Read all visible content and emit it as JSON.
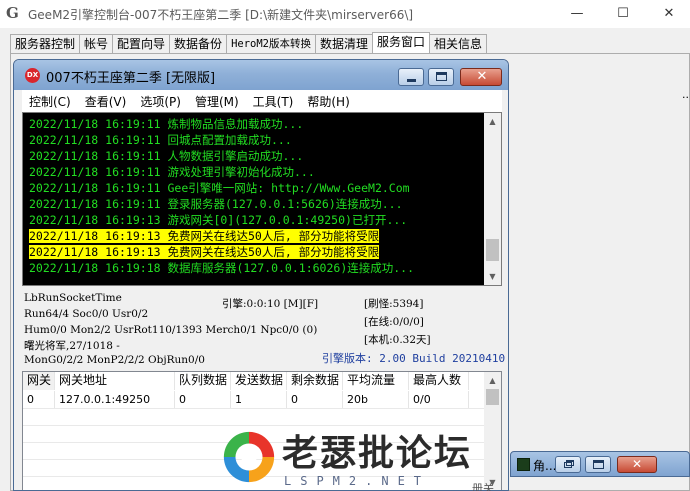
{
  "window": {
    "title": "GeeM2引擎控制台-007不朽王座第二季 [D:\\新建文件夹\\mirserver66\\]",
    "minimize": "—",
    "maximize": "☐",
    "close": "✕"
  },
  "main_tabs": [
    {
      "label": "服务器控制"
    },
    {
      "label": "帐号"
    },
    {
      "label": "配置向导"
    },
    {
      "label": "数据备份"
    },
    {
      "label": "HeroM2版本转换"
    },
    {
      "label": "数据清理"
    },
    {
      "label": "服务窗口"
    },
    {
      "label": "相关信息"
    }
  ],
  "inner_window": {
    "icon_text": "DX",
    "title": "007不朽王座第二季 [无限版]",
    "close": "✕",
    "menu": [
      {
        "label": "控制(C)"
      },
      {
        "label": "查看(V)"
      },
      {
        "label": "选项(P)"
      },
      {
        "label": "管理(M)"
      },
      {
        "label": "工具(T)"
      },
      {
        "label": "帮助(H)"
      }
    ]
  },
  "console": {
    "lines": [
      {
        "text": "2022/11/18 16:19:11 炼制物品信息加载成功..."
      },
      {
        "text": "2022/11/18 16:19:11 回城点配置加载成功..."
      },
      {
        "text": "2022/11/18 16:19:11 人物数据引擎启动成功..."
      },
      {
        "text": "2022/11/18 16:19:11 游戏处理引擎初始化成功..."
      },
      {
        "text": "2022/11/18 16:19:11 Gee引擎唯一网站: http://Www.GeeM2.Com"
      },
      {
        "text": "2022/11/18 16:19:11 登录服务器(127.0.0.1:5626)连接成功..."
      },
      {
        "text": "2022/11/18 16:19:13 游戏网关[0](127.0.0.1:49250)已打开..."
      },
      {
        "text": "2022/11/18 16:19:13 免费网关在线达50人后, 部分功能将受限"
      },
      {
        "text": "2022/11/18 16:19:13 免费网关在线达50人后, 部分功能将受限"
      },
      {
        "text": "2022/11/18 16:19:18 数据库服务器(127.0.0.1:6026)连接成功..."
      }
    ]
  },
  "status": {
    "socket": "LbRunSocketTime",
    "engine_time": "引擎:0:0:10 [M][F]",
    "refresh_monsters": "[刷怪:5394]",
    "run_stats": "Run64/4 Soc0/0 Usr0/2",
    "online": "[在线:0/0/0]",
    "hum_stats": "Hum0/0 Mon2/2 UsrRot110/1393 Merch0/1 Npc0/0 (0)",
    "local_time": "[本机:0.32天]",
    "map_info": "曙光将军,27/1018 -",
    "mon_stats": "MonG0/2/2 MonP2/2/2 ObjRun0/0",
    "engine_version": "引擎版本: 2.00 Build 20210410"
  },
  "gateway_table": {
    "columns": [
      "网关",
      "网关地址",
      "队列数据",
      "发送数据",
      "剩余数据",
      "平均流量",
      "最高人数"
    ],
    "rows": [
      [
        "0",
        "127.0.0.1:49250",
        "0",
        "1",
        "0",
        "20b",
        "0/0"
      ]
    ]
  },
  "minimized_window": {
    "title": "角...",
    "close": "✕"
  },
  "edge_text": "...",
  "bottom_text": "册关",
  "watermark": {
    "text": "老瑟批论坛",
    "sub": "LSPM2.NET"
  }
}
